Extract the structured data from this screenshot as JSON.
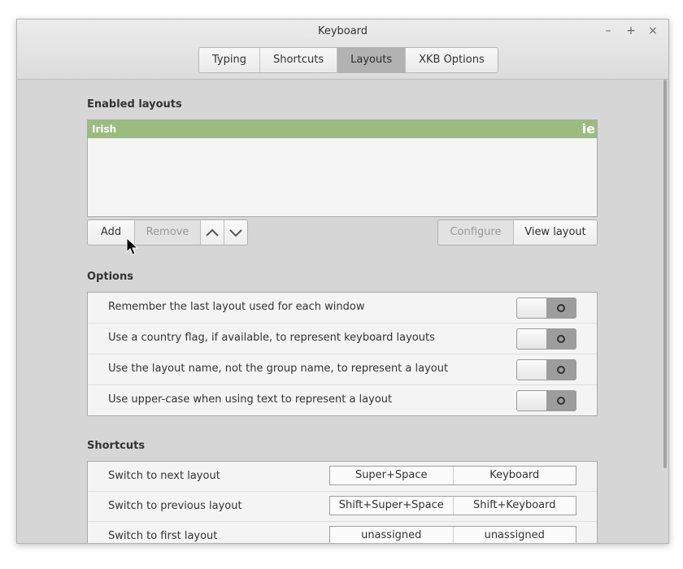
{
  "window": {
    "title": "Keyboard",
    "controls": {
      "minimize": "–",
      "maximize": "+",
      "close": "×"
    }
  },
  "tabs": [
    {
      "label": "Typing",
      "active": false
    },
    {
      "label": "Shortcuts",
      "active": false
    },
    {
      "label": "Layouts",
      "active": true
    },
    {
      "label": "XKB Options",
      "active": false
    }
  ],
  "enabled_layouts": {
    "heading": "Enabled layouts",
    "items": [
      {
        "name": "Irish",
        "code": "ie",
        "selected": true
      }
    ],
    "buttons": {
      "add": "Add",
      "remove": "Remove",
      "up_icon": "chevron-up-icon",
      "down_icon": "chevron-down-icon",
      "configure": "Configure",
      "view_layout": "View layout"
    }
  },
  "options": {
    "heading": "Options",
    "items": [
      {
        "label": "Remember the last layout used for each window",
        "enabled": false
      },
      {
        "label": "Use a country flag, if available, to represent keyboard layouts",
        "enabled": false
      },
      {
        "label": "Use the layout name, not the group name, to represent a layout",
        "enabled": false
      },
      {
        "label": "Use upper-case when using text to represent a layout",
        "enabled": false
      }
    ]
  },
  "shortcuts": {
    "heading": "Shortcuts",
    "items": [
      {
        "label": "Switch to next layout",
        "primary": "Super+Space",
        "secondary": "Keyboard"
      },
      {
        "label": "Switch to previous layout",
        "primary": "Shift+Super+Space",
        "secondary": "Shift+Keyboard"
      },
      {
        "label": "Switch to first layout",
        "primary": "unassigned",
        "secondary": "unassigned"
      }
    ]
  },
  "colors": {
    "selection": "#9bbc7e",
    "window_bg": "#d6d6d6"
  }
}
